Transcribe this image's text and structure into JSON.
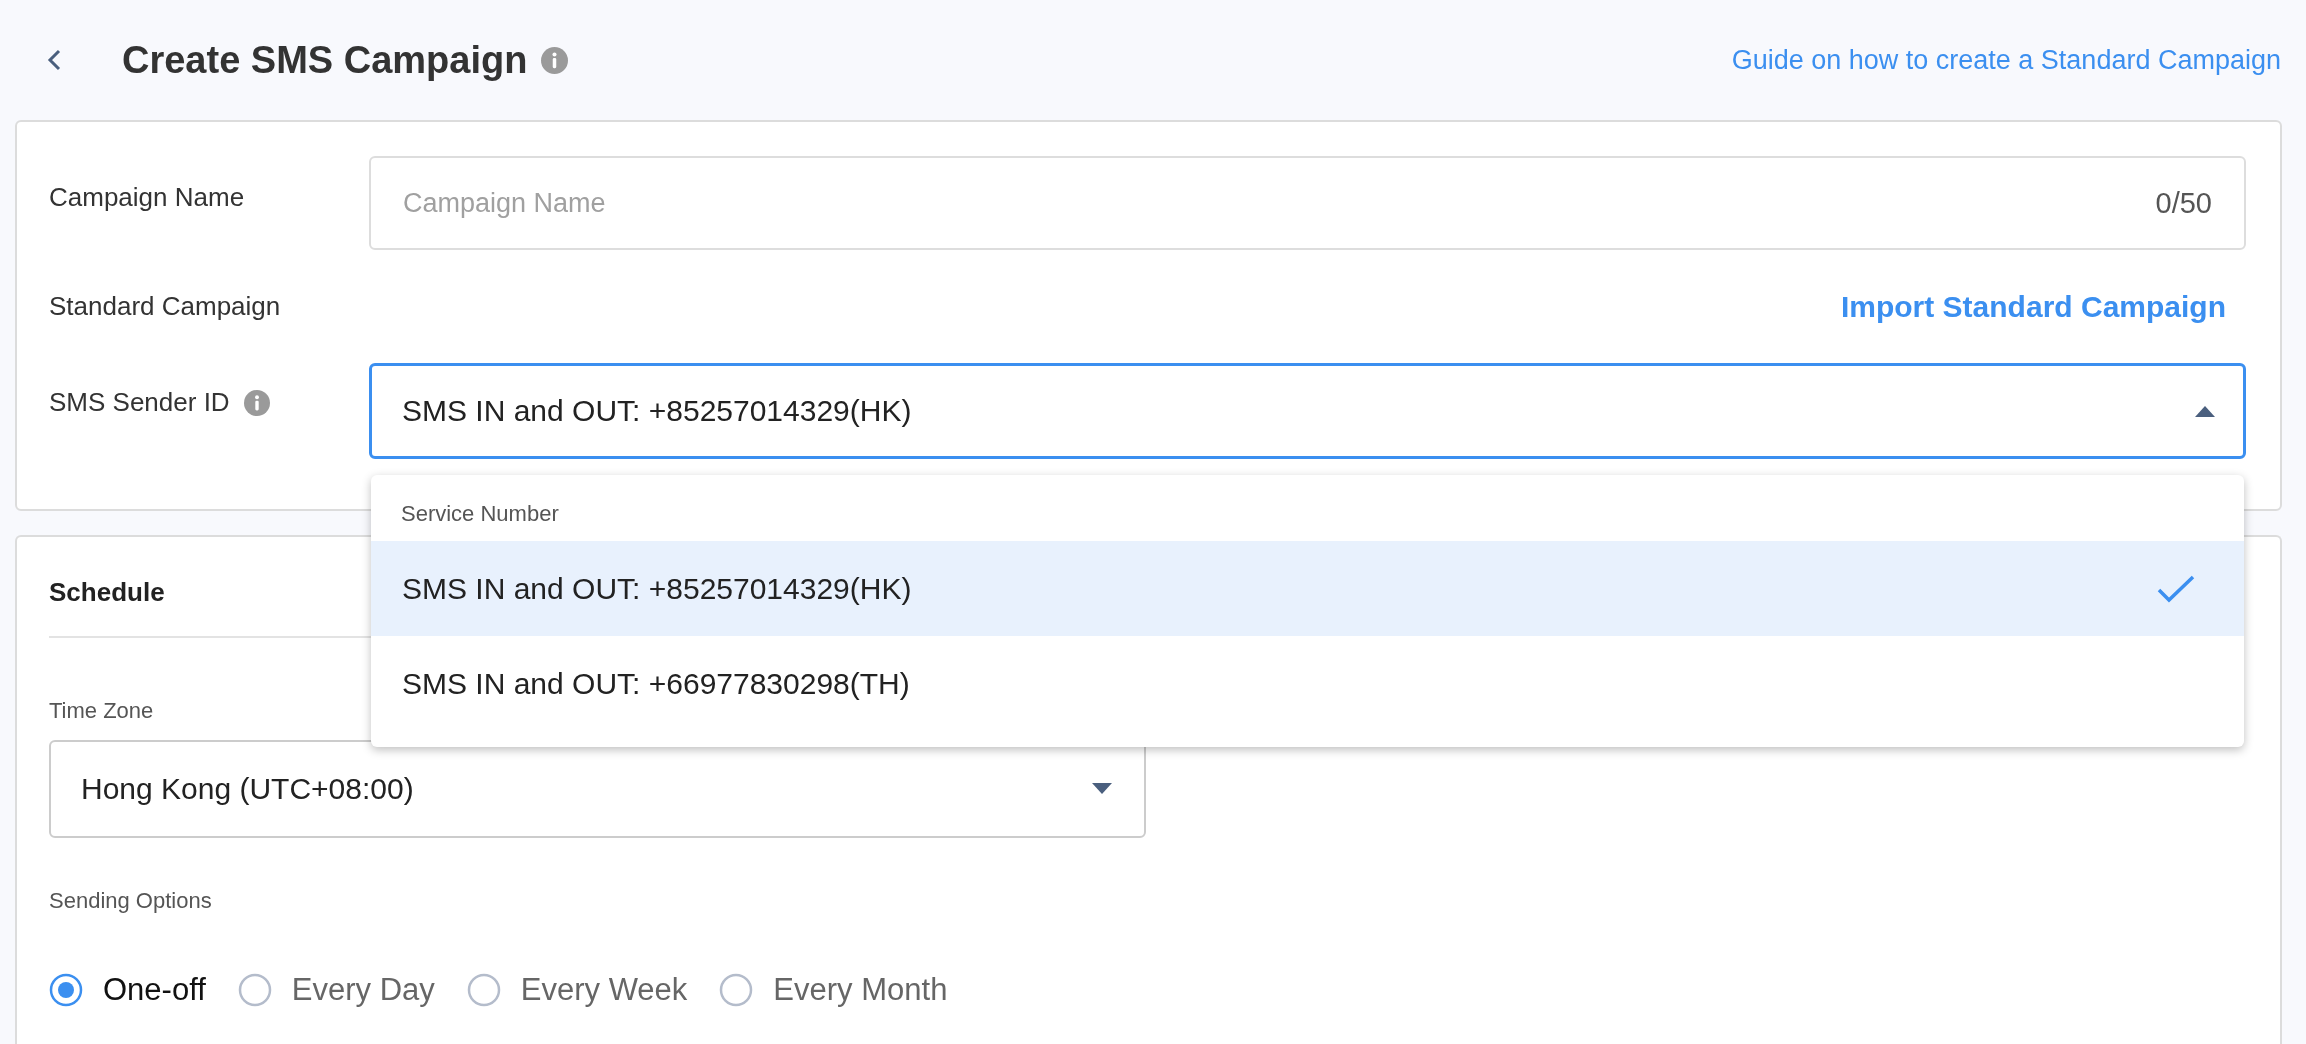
{
  "header": {
    "title": "Create SMS Campaign",
    "guide_link": "Guide on how to create a Standard Campaign"
  },
  "campaign_name": {
    "label": "Campaign Name",
    "placeholder": "Campaign Name",
    "counter": "0/50"
  },
  "standard_campaign": {
    "label": "Standard Campaign",
    "import_link": "Import Standard Campaign"
  },
  "sender_id": {
    "label": "SMS Sender ID",
    "value": "SMS IN and OUT: +85257014329(HK)",
    "expanded": true,
    "dropdown": {
      "group_label": "Service Number",
      "options": [
        {
          "label": "SMS IN and OUT: +85257014329(HK)",
          "selected": true
        },
        {
          "label": "SMS IN and OUT: +66977830298(TH)",
          "selected": false
        }
      ]
    }
  },
  "schedule": {
    "title": "Schedule",
    "time_zone": {
      "label": "Time Zone",
      "value": "Hong Kong (UTC+08:00)"
    },
    "sending_options": {
      "label": "Sending Options",
      "options": [
        {
          "label": "One-off",
          "selected": true
        },
        {
          "label": "Every Day",
          "selected": false
        },
        {
          "label": "Every Week",
          "selected": false
        },
        {
          "label": "Every Month",
          "selected": false
        }
      ]
    }
  }
}
